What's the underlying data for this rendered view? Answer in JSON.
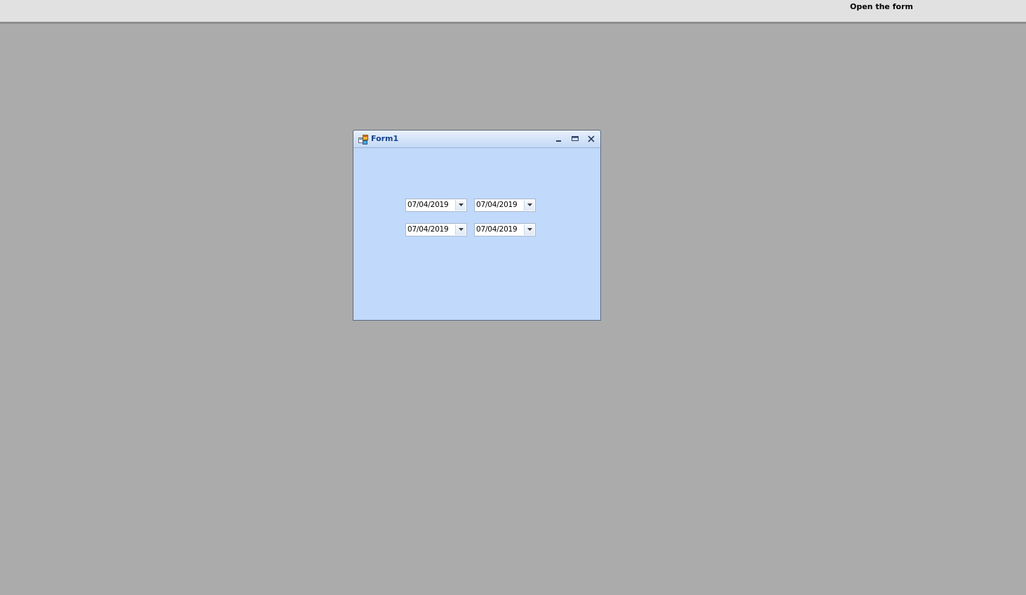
{
  "toolbar": {
    "open_form_label": "Open the form"
  },
  "form": {
    "title": "Form1",
    "controls": {
      "minimize": "minimize",
      "maximize": "maximize",
      "close": "close"
    },
    "date_pickers": [
      {
        "value": "07/04/2019"
      },
      {
        "value": "07/04/2019"
      },
      {
        "value": "07/04/2019"
      },
      {
        "value": "07/04/2019"
      }
    ]
  },
  "colors": {
    "mdi_background": "#ababab",
    "form_client": "#c1d9fb",
    "title_text": "#15428b",
    "toolbar_background": "#e1e1e1"
  },
  "icons": {
    "app": "form-app-icon",
    "minimize": "minimize-icon",
    "maximize": "maximize-icon",
    "close": "close-icon",
    "dropdown": "chevron-down-icon"
  }
}
